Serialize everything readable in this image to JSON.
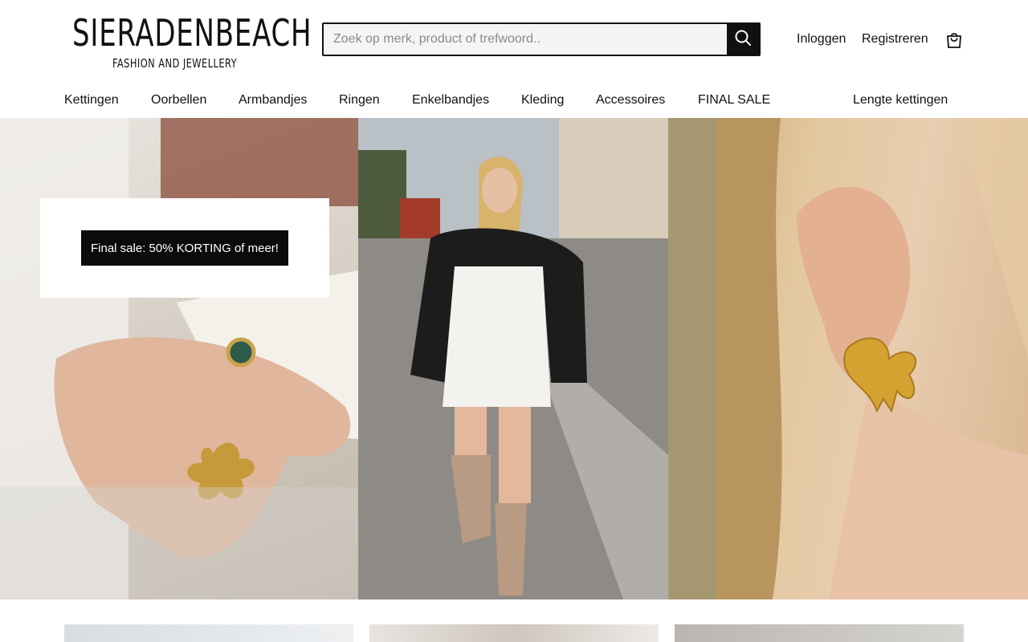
{
  "brand": {
    "name": "SIERADENBEACH",
    "tagline": "FASHION AND JEWELLERY"
  },
  "search": {
    "placeholder": "Zoek op merk, product of trefwoord..",
    "value": ""
  },
  "account": {
    "login": "Inloggen",
    "register": "Registreren"
  },
  "nav": {
    "items": [
      {
        "label": "Kettingen"
      },
      {
        "label": "Oorbellen"
      },
      {
        "label": "Armbandjes"
      },
      {
        "label": "Ringen"
      },
      {
        "label": "Enkelbandjes"
      },
      {
        "label": "Kleding"
      },
      {
        "label": "Accessoires"
      },
      {
        "label": "FINAL SALE"
      }
    ],
    "right_item": "Lengte kettingen"
  },
  "hero": {
    "promo_button": "Final sale: 50% KORTING of meer!"
  },
  "icons": {
    "search": "search-icon",
    "cart": "shopping-bag-icon"
  },
  "colors": {
    "accent": "#111111",
    "search_bg": "#f6f5f3"
  }
}
